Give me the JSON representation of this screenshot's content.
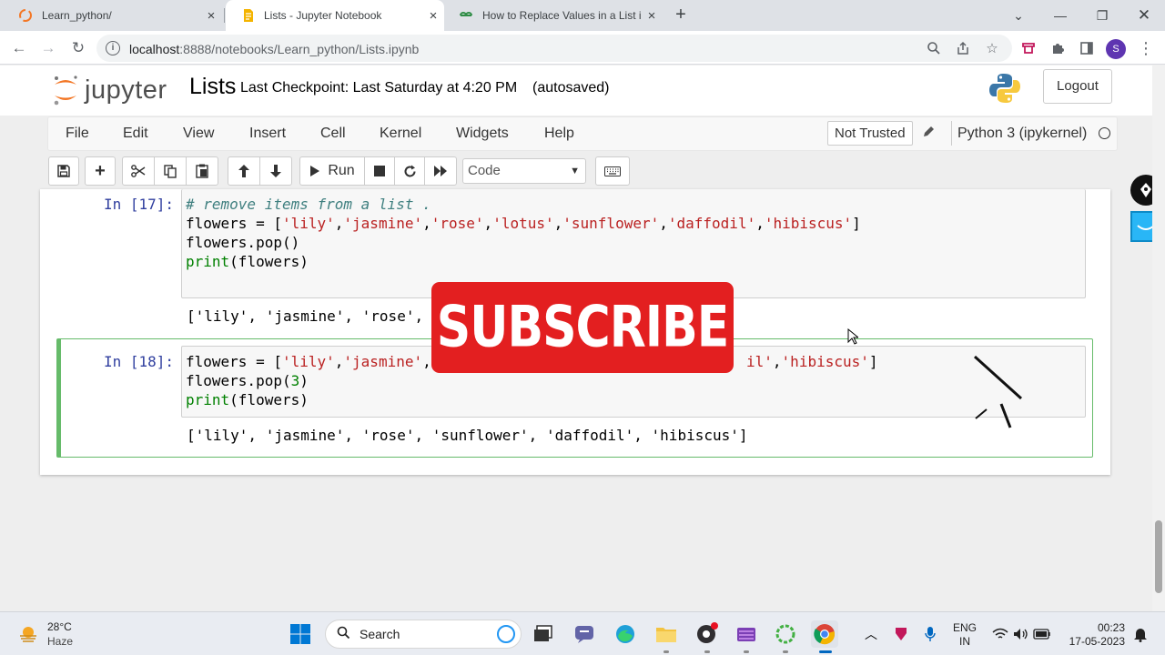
{
  "browser": {
    "tabs": [
      {
        "label": "Learn_python/",
        "close": "×",
        "active": false
      },
      {
        "label": "Lists - Jupyter Notebook",
        "close": "×",
        "active": true
      },
      {
        "label": "How to Replace Values in a List in",
        "close": "×",
        "active": false
      }
    ],
    "new_tab": "+",
    "url_host": "localhost",
    "url_rest": ":8888/notebooks/Learn_python/Lists.ipynb",
    "avatar_initial": "S"
  },
  "jupyter": {
    "logo_text": "jupyter",
    "notebook_name": "Lists",
    "checkpoint": "Last Checkpoint: Last Saturday at 4:20 PM",
    "autosave": "(autosaved)",
    "logout": "Logout",
    "menu": [
      "File",
      "Edit",
      "View",
      "Insert",
      "Cell",
      "Kernel",
      "Widgets",
      "Help"
    ],
    "trust": "Not Trusted",
    "kernel": "Python 3 (ipykernel)",
    "toolbar": {
      "run_label": "Run",
      "cell_type": "Code"
    }
  },
  "cells": [
    {
      "prompt": "In [17]:",
      "code_lines": [
        "# remove items from a list .",
        "flowers = ['lily','jasmine','rose','lotus','sunflower','daffodil','hibiscus']",
        "flowers.pop()",
        "print(flowers)"
      ],
      "output": "['lily', 'jasmine', 'rose', "
    },
    {
      "prompt": "In [18]:",
      "code_lines": [
        "flowers = ['lily','jasmine',",
        "il','hibiscus']",
        "flowers.pop(3)",
        "print(flowers)"
      ],
      "output": "['lily', 'jasmine', 'rose', 'sunflower', 'daffodil', 'hibiscus']"
    }
  ],
  "overlay": {
    "subscribe": "SUBSCRIBE"
  },
  "taskbar": {
    "temperature": "28°C",
    "weather": "Haze",
    "search": "Search",
    "lang_top": "ENG",
    "lang_bottom": "IN",
    "time": "00:23",
    "date": "17-05-2023"
  }
}
